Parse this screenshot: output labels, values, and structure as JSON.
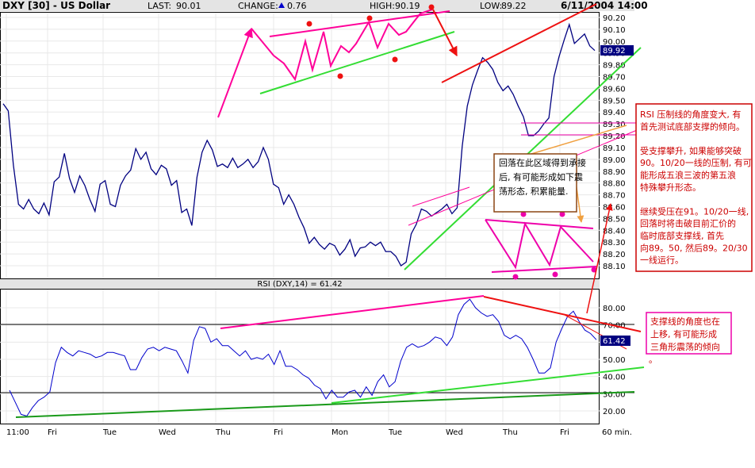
{
  "header": {
    "symbol": "DXY [30] - US Dollar",
    "last_label": "LAST:",
    "last_value": "90.01",
    "change_label": "CHANGE:",
    "change_value": "0.76",
    "high_label": "HIGH:",
    "high_value": "90.19",
    "low_label": "LOW:",
    "low_value": "89.22",
    "datetime": "6/11/2004 14:00"
  },
  "price_panel": {
    "current_tag": "89.92",
    "ytick_labels": [
      "90.20",
      "90.10",
      "90.00",
      "89.90",
      "89.80",
      "89.70",
      "89.60",
      "89.50",
      "89.40",
      "89.30",
      "89.20",
      "89.10",
      "89.00",
      "88.90",
      "88.80",
      "88.70",
      "88.60",
      "88.50",
      "88.40",
      "88.30",
      "88.20",
      "88.10"
    ]
  },
  "rsi_panel": {
    "title": "RSI (DXY,14) = 61.42",
    "current_tag": "61.42",
    "ytick_labels": [
      "80.00",
      "70.00",
      "60.00",
      "50.00",
      "40.00",
      "30.00",
      "20.00"
    ]
  },
  "x_axis": {
    "labels": [
      "11:00",
      "Fri",
      "Tue",
      "Wed",
      "Thu",
      "Fri",
      "Mon",
      "Tue",
      "Wed",
      "Thu",
      "Fri"
    ],
    "interval_label": "60 min."
  },
  "annotations": {
    "box_center": [
      "回落在此区域得到承接",
      "后, 有可能形成如下震",
      "荡形态, 积累能量."
    ],
    "box_right": [
      "RSI 压制线的角度变大, 有",
      "首先测试底部支撑的倾向。",
      "",
      "受支撑攀升, 如果能够突破",
      "90。10/20一线的压制, 有可",
      "能形成五浪三波的第五浪",
      "特殊攀升形态。",
      "",
      "继续受压在91。10/20一线,",
      "回落时将击破目前汇价的",
      "临时底部支撑线, 首先",
      "向89。50, 然后89。20/30",
      "一线运行。"
    ],
    "box_rsi": [
      "支撑线的角度也在",
      "上移, 有可能形成",
      "三角形震荡的倾向"
    ],
    "dot_small": "。"
  },
  "colors": {
    "price_line": "#000080",
    "rsi_line": "#0000cc",
    "trend_magenta": "#ff0099",
    "trend_green": "#33dd33",
    "trend_red": "#ee1111",
    "note_border_red": "#cc0000",
    "note_border_magenta": "#ee00aa",
    "note_border_brown": "#8b4513",
    "tag_fill": "#000080"
  },
  "chart_data": [
    {
      "type": "line",
      "title": "DXY [30] - US Dollar",
      "ylim": [
        88.05,
        90.25
      ],
      "x": [
        "11:00",
        "Fri",
        "Tue",
        "Wed",
        "Thu",
        "Fri",
        "Mon",
        "Tue",
        "Wed",
        "Thu",
        "Fri"
      ],
      "series": [
        {
          "values": [
            89.47,
            89.41,
            88.95,
            88.62,
            88.58,
            88.66,
            88.58,
            88.54,
            88.63,
            88.53,
            88.81,
            88.85,
            89.05,
            88.84,
            88.72,
            88.86,
            88.78,
            88.66,
            88.56,
            88.79,
            88.82,
            88.62,
            88.6,
            88.78,
            88.86,
            88.91,
            89.09,
            89.0,
            89.06,
            88.92,
            88.87,
            88.95,
            88.92,
            88.78,
            88.82,
            88.55,
            88.58,
            88.44,
            88.85,
            89.06,
            89.16,
            89.08,
            88.94,
            88.96,
            88.93,
            89.01,
            88.93,
            88.96,
            89.0,
            88.93,
            88.98,
            89.1,
            89.0,
            88.79,
            88.76,
            88.62,
            88.7,
            88.62,
            88.51,
            88.42,
            88.29,
            88.34,
            88.28,
            88.24,
            88.29,
            88.27,
            88.19,
            88.24,
            88.32,
            88.18,
            88.25,
            88.26,
            88.3,
            88.27,
            88.3,
            88.22,
            88.22,
            88.18,
            88.1,
            88.13,
            88.37,
            88.45,
            88.58,
            88.56,
            88.52,
            88.55,
            88.58,
            88.62,
            88.54,
            88.59,
            89.11,
            89.45,
            89.63,
            89.75,
            89.86,
            89.82,
            89.76,
            89.65,
            89.58,
            89.62,
            89.55,
            89.45,
            89.36,
            89.2,
            89.2,
            89.24,
            89.3,
            89.35,
            89.7,
            89.87,
            90.01,
            90.14,
            89.98,
            90.02,
            90.06,
            89.96,
            89.92
          ]
        }
      ]
    },
    {
      "type": "line",
      "title": "RSI (DXY,14) = 61.42",
      "ylim": [
        15,
        88
      ],
      "series": [
        {
          "name": "RSI (DXY,14)",
          "values": [
            32,
            25,
            18,
            17,
            22,
            26,
            28,
            31,
            48,
            57,
            54,
            52,
            55,
            54,
            53,
            51,
            52,
            54,
            54,
            53,
            52,
            44,
            44,
            51,
            56,
            57,
            55,
            57,
            56,
            55,
            49,
            42,
            61,
            69,
            68,
            60,
            62,
            58,
            58,
            55,
            52,
            55,
            50,
            51,
            50,
            53,
            47,
            55,
            46,
            46,
            44,
            41,
            39,
            35,
            33,
            27,
            32,
            28,
            28,
            31,
            32,
            28,
            34,
            29,
            37,
            41,
            34,
            37,
            49,
            57,
            59,
            57,
            58,
            60,
            63,
            62,
            58,
            63,
            76,
            82,
            85,
            80,
            77,
            75,
            76,
            72,
            64,
            62,
            64,
            62,
            57,
            50,
            42,
            42,
            45,
            60,
            68,
            75,
            78,
            72,
            67,
            65,
            61.42
          ]
        }
      ]
    }
  ]
}
